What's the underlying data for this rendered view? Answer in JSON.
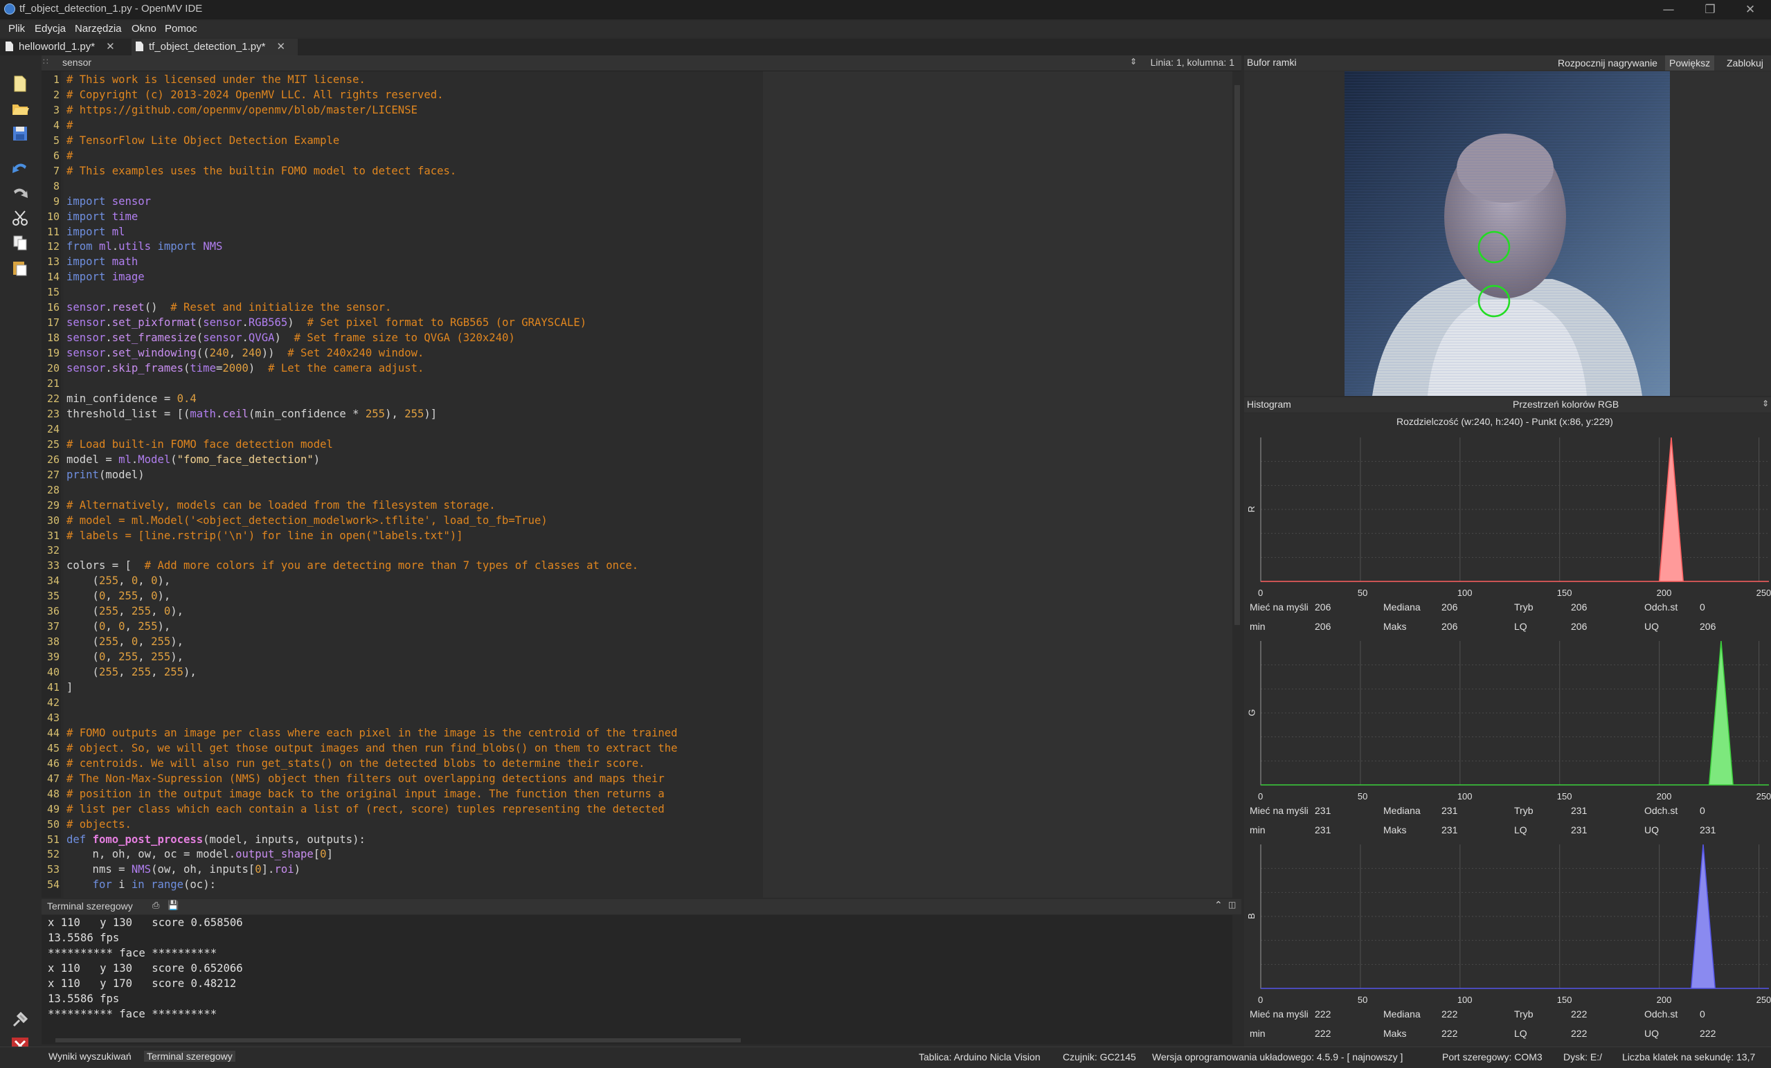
{
  "window": {
    "title": "tf_object_detection_1.py - OpenMV IDE"
  },
  "menu": [
    "Plik",
    "Edycja",
    "Narzędzia",
    "Okno",
    "Pomoc"
  ],
  "tabs": [
    {
      "label": "helloworld_1.py*",
      "active": false
    },
    {
      "label": "tf_object_detection_1.py*",
      "active": true
    }
  ],
  "editor": {
    "header_label": "sensor",
    "cursor_position": "Linia: 1, kolumna: 1"
  },
  "code_lines": [
    {
      "n": "1",
      "html": "<span class='cm'># This work is licensed under the MIT license.</span>"
    },
    {
      "n": "2",
      "html": "<span class='cm'># Copyright (c) 2013-2024 OpenMV LLC. All rights reserved.</span>"
    },
    {
      "n": "3",
      "html": "<span class='cm'># https://github.com/openmv/openmv/blob/master/LICENSE</span>"
    },
    {
      "n": "4",
      "html": "<span class='cm'>#</span>"
    },
    {
      "n": "5",
      "html": "<span class='cm'># TensorFlow Lite Object Detection Example</span>"
    },
    {
      "n": "6",
      "html": "<span class='cm'>#</span>"
    },
    {
      "n": "7",
      "html": "<span class='cm'># This examples uses the builtin FOMO model to detect faces.</span>"
    },
    {
      "n": "8",
      "html": ""
    },
    {
      "n": "9",
      "html": "<span class='kw'>import</span> <span class='mod'>sensor</span>"
    },
    {
      "n": "10",
      "html": "<span class='kw'>import</span> <span class='mod'>time</span>"
    },
    {
      "n": "11",
      "html": "<span class='kw'>import</span> <span class='mod'>ml</span>"
    },
    {
      "n": "12",
      "html": "<span class='kw'>from</span> <span class='mod'>ml</span>.<span class='mod'>utils</span> <span class='kw'>import</span> <span class='mod'>NMS</span>"
    },
    {
      "n": "13",
      "html": "<span class='kw'>import</span> <span class='mod'>math</span>"
    },
    {
      "n": "14",
      "html": "<span class='kw'>import</span> <span class='mod'>image</span>"
    },
    {
      "n": "15",
      "html": ""
    },
    {
      "n": "16",
      "html": "<span class='mod'>sensor</span>.<span class='fn'>reset</span>()  <span class='cm'># Reset and initialize the sensor.</span>"
    },
    {
      "n": "17",
      "html": "<span class='mod'>sensor</span>.<span class='fn'>set_pixformat</span>(<span class='mod'>sensor</span>.<span class='mod'>RGB565</span>)  <span class='cm'># Set pixel format to RGB565 (or GRAYSCALE)</span>"
    },
    {
      "n": "18",
      "html": "<span class='mod'>sensor</span>.<span class='fn'>set_framesize</span>(<span class='mod'>sensor</span>.<span class='mod'>QVGA</span>)  <span class='cm'># Set frame size to QVGA (320x240)</span>"
    },
    {
      "n": "19",
      "html": "<span class='mod'>sensor</span>.<span class='fn'>set_windowing</span>((<span class='num'>240</span>, <span class='num'>240</span>))  <span class='cm'># Set 240x240 window.</span>"
    },
    {
      "n": "20",
      "html": "<span class='mod'>sensor</span>.<span class='fn'>skip_frames</span>(<span class='mod'>time</span>=<span class='num'>2000</span>)  <span class='cm'># Let the camera adjust.</span>"
    },
    {
      "n": "21",
      "html": ""
    },
    {
      "n": "22",
      "html": "min_confidence = <span class='num'>0.4</span>"
    },
    {
      "n": "23",
      "html": "threshold_list = [(<span class='mod'>math</span>.<span class='fn'>ceil</span>(min_confidence * <span class='num'>255</span>), <span class='num'>255</span>)]"
    },
    {
      "n": "24",
      "html": ""
    },
    {
      "n": "25",
      "html": "<span class='cm'># Load built-in FOMO face detection model</span>"
    },
    {
      "n": "26",
      "html": "model = <span class='mod'>ml</span>.<span class='mod'>Model</span>(<span class='str'>\"fomo_face_detection\"</span>)"
    },
    {
      "n": "27",
      "html": "<span class='kw'>print</span>(model)"
    },
    {
      "n": "28",
      "html": ""
    },
    {
      "n": "29",
      "html": "<span class='cm'># Alternatively, models can be loaded from the filesystem storage.</span>"
    },
    {
      "n": "30",
      "html": "<span class='cm'># model = ml.Model('&lt;object_detection_modelwork&gt;.tflite', load_to_fb=True)</span>"
    },
    {
      "n": "31",
      "html": "<span class='cm'># labels = [line.rstrip('\\n') for line in open(\"labels.txt\")]</span>"
    },
    {
      "n": "32",
      "html": ""
    },
    {
      "n": "33",
      "html": "colors = [  <span class='cm'># Add more colors if you are detecting more than 7 types of classes at once.</span>"
    },
    {
      "n": "34",
      "html": "    (<span class='num'>255</span>, <span class='num'>0</span>, <span class='num'>0</span>),"
    },
    {
      "n": "35",
      "html": "    (<span class='num'>0</span>, <span class='num'>255</span>, <span class='num'>0</span>),"
    },
    {
      "n": "36",
      "html": "    (<span class='num'>255</span>, <span class='num'>255</span>, <span class='num'>0</span>),"
    },
    {
      "n": "37",
      "html": "    (<span class='num'>0</span>, <span class='num'>0</span>, <span class='num'>255</span>),"
    },
    {
      "n": "38",
      "html": "    (<span class='num'>255</span>, <span class='num'>0</span>, <span class='num'>255</span>),"
    },
    {
      "n": "39",
      "html": "    (<span class='num'>0</span>, <span class='num'>255</span>, <span class='num'>255</span>),"
    },
    {
      "n": "40",
      "html": "    (<span class='num'>255</span>, <span class='num'>255</span>, <span class='num'>255</span>),"
    },
    {
      "n": "41",
      "html": "]"
    },
    {
      "n": "42",
      "html": ""
    },
    {
      "n": "43",
      "html": ""
    },
    {
      "n": "44",
      "html": "<span class='cm'># FOMO outputs an image per class where each pixel in the image is the centroid of the trained</span>"
    },
    {
      "n": "45",
      "html": "<span class='cm'># object. So, we will get those output images and then run find_blobs() on them to extract the</span>"
    },
    {
      "n": "46",
      "html": "<span class='cm'># centroids. We will also run get_stats() on the detected blobs to determine their score.</span>"
    },
    {
      "n": "47",
      "html": "<span class='cm'># The Non-Max-Supression (NMS) object then filters out overlapping detections and maps their</span>"
    },
    {
      "n": "48",
      "html": "<span class='cm'># position in the output image back to the original input image. The function then returns a</span>"
    },
    {
      "n": "49",
      "html": "<span class='cm'># list per class which each contain a list of (rect, score) tuples representing the detected</span>"
    },
    {
      "n": "50",
      "html": "<span class='cm'># objects.</span>"
    },
    {
      "n": "51",
      "html": "<span class='kw'>def</span> <span class='fnb'>fomo_post_process</span>(model, inputs, outputs):"
    },
    {
      "n": "52",
      "html": "    n, oh, ow, oc = model.<span class='fn'>output_shape</span>[<span class='num'>0</span>]"
    },
    {
      "n": "53",
      "html": "    nms = <span class='mod'>NMS</span>(ow, oh, inputs[<span class='num'>0</span>].<span class='fn'>roi</span>)"
    },
    {
      "n": "54",
      "html": "    <span class='kw'>for</span> i <span class='kw'>in</span> <span class='kw'>range</span>(oc):"
    }
  ],
  "terminal": {
    "title": "Terminal szeregowy",
    "lines": [
      "x 110   y 130   score 0.658506",
      "13.5586 fps",
      "********** face **********",
      "x 110   y 130   score 0.652066",
      "x 110   y 170   score 0.48212",
      "13.5586 fps",
      "********** face **********"
    ]
  },
  "bottom_tabs": [
    "Wyniki wyszukiwań",
    "Terminal szeregowy"
  ],
  "status": {
    "board": "Tablica: Arduino Nicla Vision",
    "sensor": "Czujnik: GC2145",
    "firmware": "Wersja oprogramowania układowego: 4.5.9 - [ najnowszy ]",
    "port": "Port szeregowy: COM3",
    "drive": "Dysk: E:/",
    "fps": "Liczba klatek na sekundę: 13,7"
  },
  "framebuffer": {
    "title": "Bufor ramki",
    "record_button": "Rozpocznij nagrywanie",
    "zoom_button": "Powiększ",
    "lock_button": "Zablokuj"
  },
  "histogram": {
    "title": "Histogram",
    "colorspace": "Przestrzeń kolorów RGB",
    "info": "Rozdzielczość (w:240, h:240) - Punkt (x:86, y:229)",
    "stat_labels": [
      "Mieć na myśli",
      "Mediana",
      "Tryb",
      "Odch.st",
      "min",
      "Maks",
      "LQ",
      "UQ"
    ],
    "channels": [
      {
        "name": "R",
        "color": "#ff9a9a",
        "stroke": "#ff6060",
        "mean": "206",
        "median": "206",
        "mode": "206",
        "stdev": "0",
        "min": "206",
        "max": "206",
        "lq": "206",
        "uq": "206"
      },
      {
        "name": "G",
        "color": "#7de87d",
        "stroke": "#3cd03c",
        "mean": "231",
        "median": "231",
        "mode": "231",
        "stdev": "0",
        "min": "231",
        "max": "231",
        "lq": "231",
        "uq": "231"
      },
      {
        "name": "B",
        "color": "#8a8af0",
        "stroke": "#5555e8",
        "mean": "222",
        "median": "222",
        "mode": "222",
        "stdev": "0",
        "min": "222",
        "max": "222",
        "lq": "222",
        "uq": "222"
      }
    ],
    "ticks": [
      "0",
      "50",
      "100",
      "150",
      "200",
      "250"
    ]
  },
  "chart_data": [
    {
      "type": "area",
      "ylabel": "R",
      "x": [
        0,
        200,
        206,
        212,
        255
      ],
      "y": [
        0,
        0,
        1,
        0,
        0
      ],
      "xlim": [
        0,
        255
      ]
    },
    {
      "type": "area",
      "ylabel": "G",
      "x": [
        0,
        225,
        231,
        237,
        255
      ],
      "y": [
        0,
        0,
        1,
        0,
        0
      ],
      "xlim": [
        0,
        255
      ]
    },
    {
      "type": "area",
      "ylabel": "B",
      "x": [
        0,
        216,
        222,
        228,
        255
      ],
      "y": [
        0,
        0,
        1,
        0,
        0
      ],
      "xlim": [
        0,
        255
      ]
    }
  ]
}
